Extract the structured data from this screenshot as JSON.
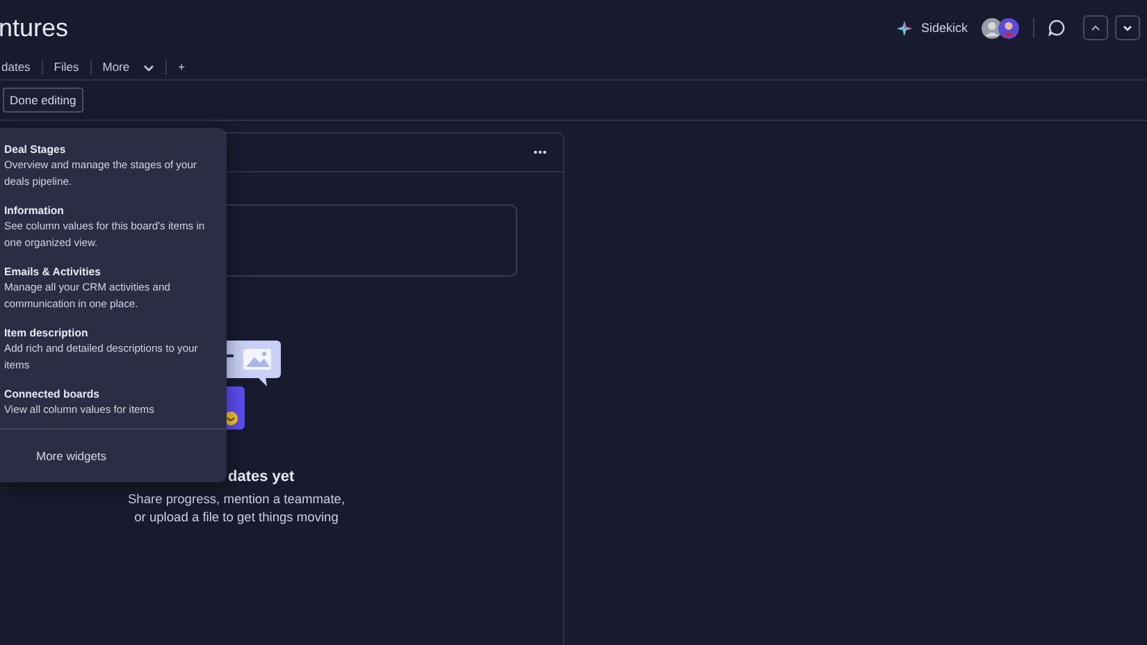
{
  "board": {
    "title": "ntures",
    "sidekick": "Sidekick"
  },
  "tabs": [
    {
      "label": "dates",
      "kind": "tab"
    },
    {
      "label": "Files",
      "kind": "tab"
    },
    {
      "label": "More",
      "kind": "dropdown"
    },
    {
      "label": "+",
      "kind": "add"
    }
  ],
  "edit_bar": {
    "button": "Done editing"
  },
  "updates_panel": {
    "empty_title": "dates yet",
    "empty_message": "Share progress, mention a teammate, or upload a file to get things moving"
  },
  "widget_menu": {
    "items": [
      {
        "title": "Deal Stages",
        "description": "Overview and manage the stages of your deals pipeline."
      },
      {
        "title": "Information",
        "description": "See column values for this board's items in one organized view."
      },
      {
        "title": "Emails & Activities",
        "description": "Manage all your CRM activities and communication in one place."
      },
      {
        "title": "Item description",
        "description": "Add rich and detailed descriptions to your items"
      },
      {
        "title": "Connected boards",
        "description": "View all column values for items"
      }
    ],
    "footer": "More widgets"
  }
}
